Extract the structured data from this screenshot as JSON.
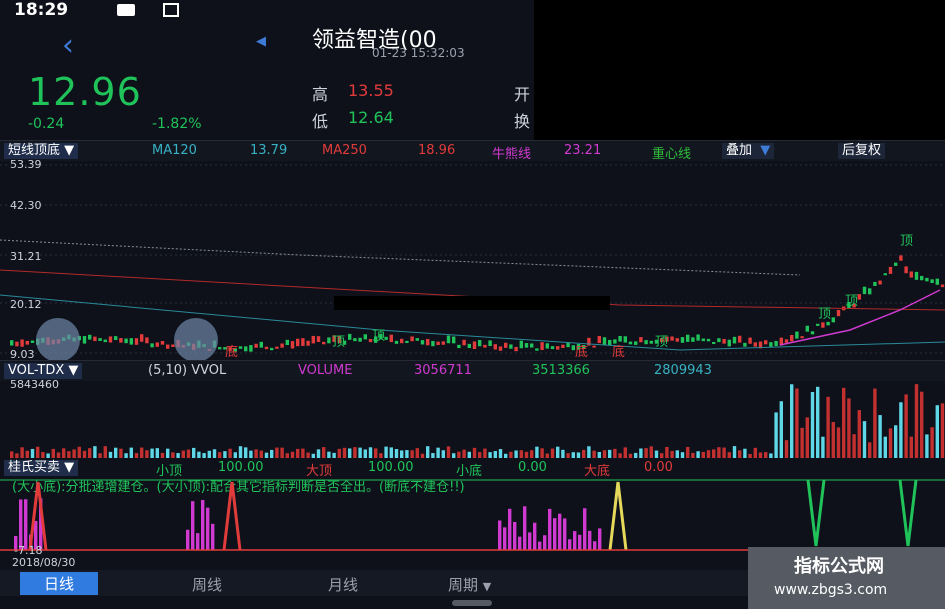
{
  "status": {
    "time": "18:29"
  },
  "header": {
    "back_icon": "chevron-left-icon",
    "title": "领益智造(00",
    "subtitle": "01-23 15:32:03",
    "price": "12.96",
    "change": "-0.24",
    "change_pct": "-1.82%",
    "high_label": "高",
    "high_value": "13.55",
    "low_label": "低",
    "low_value": "12.64",
    "open_label_partial": "开",
    "turnover_label_partial": "换"
  },
  "indicator_bar": {
    "selector": "短线顶底",
    "ma120_label": "MA120",
    "ma120_value": "13.79",
    "ma250_label": "MA250",
    "ma250_value": "18.96",
    "bull_label": "牛熊线",
    "bull_value": "23.21",
    "center_label": "重心线",
    "overlay_button": "叠加",
    "restore_button": "后复权"
  },
  "price_axis": {
    "labels": [
      "53.39",
      "42.30",
      "31.21",
      "20.12",
      "9.03"
    ]
  },
  "annotations": {
    "top": "顶",
    "bottom": "底"
  },
  "volume_bar": {
    "selector": "VOL-TDX",
    "params": "(5,10) VVOL",
    "volume_label": "VOLUME",
    "volume_value": "3056711",
    "ma5_value": "3513366",
    "ma10_value": "2809943",
    "ymax": "5843460"
  },
  "indicator2_bar": {
    "selector": "桂氏买卖",
    "small_top_label": "小顶",
    "small_top_value": "100.00",
    "big_top_label": "大顶",
    "big_top_value": "100.00",
    "small_bottom_label": "小底",
    "small_bottom_value": "0.00",
    "big_bottom_label": "大底",
    "big_bottom_value": "0.00",
    "description": "(大小底):分批递增建仓。(大小顶):配合其它指标判断是否全出。(断底不建仓!!)",
    "ymin": "-7.18"
  },
  "x_axis": {
    "start_date": "2018/08/30"
  },
  "tabs": [
    "日线",
    "周线",
    "月线",
    "周期"
  ],
  "watermark": {
    "title": "指标公式网",
    "url": "www.zbgs3.com"
  },
  "colors": {
    "up": "#e23b3b",
    "down": "#20c35a",
    "accent": "#2f7be0"
  }
}
